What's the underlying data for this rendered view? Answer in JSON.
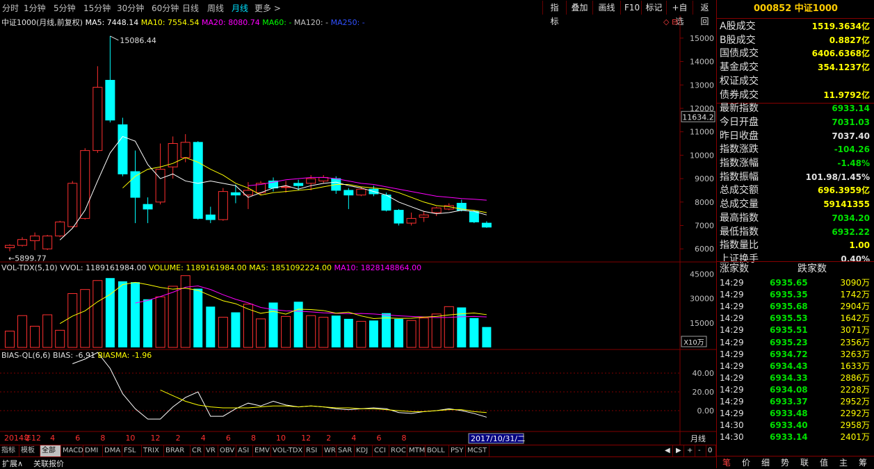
{
  "periods": [
    "分时",
    "1分钟",
    "5分钟",
    "15分钟",
    "30分钟",
    "60分钟",
    "日线",
    "周线",
    "月线",
    "更多 >"
  ],
  "active_period": "月线",
  "tools": [
    "指标",
    "叠加",
    "画线",
    "F10",
    "标记",
    "+自选",
    "返回"
  ],
  "header": {
    "name": "中证1000(月线,前复权)",
    "ma5": "MA5: 7448.14",
    "ma10": "MA10: 7554.54",
    "ma20": "MA20: 8080.74",
    "ma60": "MA60: -",
    "ma120": "MA120: -",
    "ma250": "MA250: -"
  },
  "vol_header": {
    "name": "VOL-TDX(5,10)",
    "vvol": "VVOL: 1189161984.00",
    "volume": "VOLUME: 1189161984.00",
    "ma5": "MA5: 1851092224.00",
    "ma10": "MA10: 1828148864.00"
  },
  "bias_header": {
    "name": "BIAS-QL(6,6)",
    "bias": "BIAS: -6.91",
    "biasma": "BIASMA: -1.96"
  },
  "colors": {
    "up": "#ff3030",
    "down": "#00ffff",
    "ma5": "#ffffff",
    "ma10": "#ffff00",
    "ma20": "#ff00ff",
    "ma60": "#00ff00",
    "ma250": "#0000ff",
    "grid": "#800000"
  },
  "chart_data": {
    "type": "candlestick",
    "price_axis": [
      "15000",
      "14000",
      "13000",
      "12000",
      "11000",
      "10000",
      "9000",
      "8000",
      "7000",
      "6000"
    ],
    "price_range": [
      5650,
      15500
    ],
    "high_label": "15086.44",
    "low_label": "5899.77",
    "current_tag": "11634.2",
    "candles": [
      {
        "o": 6050,
        "c": 6150,
        "h": 6200,
        "l": 5900
      },
      {
        "o": 6150,
        "c": 6400,
        "h": 6500,
        "l": 6100
      },
      {
        "o": 6350,
        "c": 6550,
        "h": 6700,
        "l": 5950
      },
      {
        "o": 6000,
        "c": 6550,
        "h": 6600,
        "l": 5950
      },
      {
        "o": 6550,
        "c": 7150,
        "h": 7200,
        "l": 6500
      },
      {
        "o": 6950,
        "c": 8800,
        "h": 8900,
        "l": 6900
      },
      {
        "o": 7300,
        "c": 10200,
        "h": 10300,
        "l": 7250
      },
      {
        "o": 10200,
        "c": 12900,
        "h": 13800,
        "l": 10100
      },
      {
        "o": 13200,
        "c": 11500,
        "h": 15086,
        "l": 11400
      },
      {
        "o": 11300,
        "c": 9200,
        "h": 11600,
        "l": 9100
      },
      {
        "o": 9300,
        "c": 8200,
        "h": 10200,
        "l": 7100
      },
      {
        "o": 7900,
        "c": 7700,
        "h": 8200,
        "l": 7100
      },
      {
        "o": 8000,
        "c": 9400,
        "h": 10500,
        "l": 7900
      },
      {
        "o": 9500,
        "c": 10500,
        "h": 10800,
        "l": 9000
      },
      {
        "o": 9900,
        "c": 10550,
        "h": 10900,
        "l": 9700
      },
      {
        "o": 10550,
        "c": 7300,
        "h": 10600,
        "l": 7250
      },
      {
        "o": 7450,
        "c": 7250,
        "h": 7800,
        "l": 7100
      },
      {
        "o": 7250,
        "c": 8450,
        "h": 8600,
        "l": 7200
      },
      {
        "o": 8400,
        "c": 8300,
        "h": 8750,
        "l": 7950
      },
      {
        "o": 8300,
        "c": 8500,
        "h": 8850,
        "l": 7700
      },
      {
        "o": 8400,
        "c": 8800,
        "h": 8900,
        "l": 8300
      },
      {
        "o": 8900,
        "c": 8600,
        "h": 9050,
        "l": 8450
      },
      {
        "o": 8650,
        "c": 8650,
        "h": 8900,
        "l": 8400
      },
      {
        "o": 8800,
        "c": 8700,
        "h": 8950,
        "l": 8500
      },
      {
        "o": 8800,
        "c": 9000,
        "h": 9150,
        "l": 8500
      },
      {
        "o": 8900,
        "c": 9050,
        "h": 9150,
        "l": 8800
      },
      {
        "o": 9000,
        "c": 8500,
        "h": 9100,
        "l": 8350
      },
      {
        "o": 8500,
        "c": 8300,
        "h": 8600,
        "l": 7700
      },
      {
        "o": 8300,
        "c": 8550,
        "h": 8650,
        "l": 8250
      },
      {
        "o": 8550,
        "c": 8350,
        "h": 8700,
        "l": 8250
      },
      {
        "o": 8300,
        "c": 7650,
        "h": 8400,
        "l": 7600
      },
      {
        "o": 7650,
        "c": 7100,
        "h": 7700,
        "l": 7000
      },
      {
        "o": 7100,
        "c": 7300,
        "h": 7550,
        "l": 7000
      },
      {
        "o": 7350,
        "c": 7450,
        "h": 7600,
        "l": 7150
      },
      {
        "o": 7550,
        "c": 7750,
        "h": 7800,
        "l": 7400
      },
      {
        "o": 7700,
        "c": 7850,
        "h": 7950,
        "l": 7650
      },
      {
        "o": 7950,
        "c": 7650,
        "h": 8100,
        "l": 7600
      },
      {
        "o": 7600,
        "c": 7150,
        "h": 7650,
        "l": 7100
      },
      {
        "o": 7100,
        "c": 6930,
        "h": 7180,
        "l": 6900
      }
    ],
    "ma5": [
      null,
      null,
      null,
      null,
      6380,
      6880,
      7650,
      8900,
      10100,
      10800,
      10600,
      9600,
      9000,
      9200,
      8900,
      8800,
      8900,
      8800,
      8700,
      8200,
      8400,
      8600,
      8700,
      8550,
      8700,
      8800,
      8850,
      8700,
      8600,
      8450,
      8300,
      8000,
      7800,
      7600,
      7500,
      7550,
      7650,
      7600,
      7450
    ],
    "ma10": [
      null,
      null,
      null,
      null,
      null,
      null,
      null,
      null,
      null,
      8600,
      9100,
      9400,
      9500,
      9650,
      9900,
      9700,
      9400,
      9150,
      8800,
      8600,
      8300,
      8400,
      8450,
      8500,
      8550,
      8650,
      8750,
      8750,
      8650,
      8600,
      8550,
      8400,
      8200,
      8000,
      7850,
      7800,
      7700,
      7650,
      7550
    ],
    "ma20": [
      null,
      null,
      null,
      null,
      null,
      null,
      null,
      null,
      null,
      null,
      null,
      null,
      null,
      null,
      null,
      null,
      null,
      null,
      null,
      8700,
      8750,
      8850,
      8950,
      9000,
      9050,
      9050,
      9000,
      8900,
      8800,
      8750,
      8650,
      8550,
      8450,
      8350,
      8250,
      8200,
      8150,
      8120,
      8080
    ],
    "vol_axis": [
      "45000",
      "30000",
      "15000"
    ],
    "vol_unit": "X10万",
    "volume": [
      10000,
      19500,
      13000,
      20000,
      10500,
      33000,
      35500,
      41000,
      42500,
      40500,
      40000,
      29500,
      31000,
      37500,
      44000,
      36000,
      25000,
      18500,
      21500,
      26500,
      17500,
      27500,
      19000,
      28000,
      19500,
      18500,
      19500,
      17500,
      16000,
      16500,
      21000,
      17500,
      16500,
      18000,
      20500,
      25000,
      24500,
      18000,
      12500
    ],
    "vol_ma5": [
      null,
      null,
      null,
      null,
      14600,
      19200,
      22400,
      28000,
      32500,
      38500,
      39900,
      38500,
      36800,
      35700,
      36300,
      35000,
      31700,
      28600,
      26800,
      23500,
      20900,
      22100,
      20400,
      23400,
      23200,
      22600,
      21000,
      21600,
      19300,
      17700,
      18100,
      17800,
      17900,
      18600,
      19000,
      19900,
      20600,
      21100,
      20100
    ],
    "vol_ma10": [
      null,
      null,
      null,
      null,
      null,
      null,
      null,
      null,
      null,
      null,
      27200,
      28800,
      31200,
      33800,
      36900,
      37700,
      35500,
      32300,
      29500,
      27300,
      24500,
      23200,
      22400,
      22200,
      21800,
      21200,
      20900,
      20700,
      20800,
      20500,
      19900,
      19400,
      19000,
      18700,
      18300,
      18400,
      18800,
      19000,
      18700
    ],
    "bias_axis": [
      "40.00",
      "20.00",
      "0.00"
    ],
    "bias": [
      null,
      null,
      null,
      null,
      null,
      50,
      55,
      62,
      45,
      18,
      2,
      -9,
      -9,
      4,
      14,
      20,
      -6,
      -6,
      2,
      8,
      5,
      10,
      6,
      4,
      5,
      4,
      2,
      1,
      2,
      3,
      2,
      -2,
      -3,
      -1,
      0,
      2,
      0,
      -3,
      -7
    ],
    "biasma": [
      null,
      null,
      null,
      null,
      null,
      null,
      null,
      null,
      null,
      null,
      null,
      null,
      22,
      16,
      10,
      6,
      4,
      3,
      3,
      3,
      4,
      5,
      5,
      4,
      5,
      4,
      3,
      3,
      2,
      2,
      1,
      0,
      -1,
      -1,
      0,
      1,
      1,
      -1,
      -2
    ],
    "x_labels": [
      "2014年12",
      "2",
      "4",
      "6",
      "8",
      "10",
      "12",
      "2",
      "4",
      "6",
      "8",
      "10",
      "12",
      "2",
      "4",
      "6",
      "8"
    ],
    "cursor_date": "2017/10/31/二",
    "period_tag": "月线"
  },
  "right_panel": {
    "title": "000852 中证1000",
    "rows": [
      {
        "label": "A股成交",
        "value": "1519.3634亿",
        "color": "#ffff00"
      },
      {
        "label": "B股成交",
        "value": "0.8827亿",
        "color": "#ffff00"
      },
      {
        "label": "国债成交",
        "value": "6406.6368亿",
        "color": "#ffff00"
      },
      {
        "label": "基金成交",
        "value": "354.1237亿",
        "color": "#ffff00"
      },
      {
        "label": "权证成交",
        "value": "",
        "color": "#ffff00"
      },
      {
        "label": "债券成交",
        "value": "11.9792亿",
        "color": "#ffff00"
      },
      {
        "label": "最新指数",
        "value": "6933.14",
        "color": "#00e000"
      },
      {
        "label": "今日开盘",
        "value": "7031.03",
        "color": "#00e000"
      },
      {
        "label": "昨日收盘",
        "value": "7037.40",
        "color": "#e0e0e0"
      },
      {
        "label": "指数涨跌",
        "value": "-104.26",
        "color": "#00e000"
      },
      {
        "label": "指数涨幅",
        "value": "-1.48%",
        "color": "#00e000"
      },
      {
        "label": "指数振幅",
        "value": "101.98/1.45%",
        "color": "#e0e0e0"
      },
      {
        "label": "总成交额",
        "value": "696.3959亿",
        "color": "#ffff00"
      },
      {
        "label": "总成交量",
        "value": "59141355",
        "color": "#ffff00"
      },
      {
        "label": "最高指数",
        "value": "7034.20",
        "color": "#00e000"
      },
      {
        "label": "最低指数",
        "value": "6932.22",
        "color": "#00e000"
      },
      {
        "label": "指数量比",
        "value": "1.00",
        "color": "#ffff00"
      },
      {
        "label": "上证换手",
        "value": "0.40%",
        "color": "#e0e0e0"
      }
    ],
    "rise_label": "涨家数",
    "fall_label": "跌家数",
    "ticks": [
      {
        "time": "14:29",
        "price": "6935.65",
        "vol": "3090万"
      },
      {
        "time": "14:29",
        "price": "6935.35",
        "vol": "1742万"
      },
      {
        "time": "14:29",
        "price": "6935.68",
        "vol": "2904万"
      },
      {
        "time": "14:29",
        "price": "6935.53",
        "vol": "1642万"
      },
      {
        "time": "14:29",
        "price": "6935.51",
        "vol": "3071万"
      },
      {
        "time": "14:29",
        "price": "6935.23",
        "vol": "2356万"
      },
      {
        "time": "14:29",
        "price": "6934.72",
        "vol": "3263万"
      },
      {
        "time": "14:29",
        "price": "6934.43",
        "vol": "1633万"
      },
      {
        "time": "14:29",
        "price": "6934.33",
        "vol": "2886万"
      },
      {
        "time": "14:29",
        "price": "6934.08",
        "vol": "2228万"
      },
      {
        "time": "14:29",
        "price": "6933.37",
        "vol": "2952万"
      },
      {
        "time": "14:29",
        "price": "6933.48",
        "vol": "2292万"
      },
      {
        "time": "14:30",
        "price": "6933.40",
        "vol": "2958万"
      },
      {
        "time": "14:30",
        "price": "6933.14",
        "vol": "2401万"
      }
    ],
    "footer": [
      "笔",
      "价",
      "细",
      "势",
      "联",
      "值",
      "主",
      "筹"
    ]
  },
  "bottom_tabs": [
    "指标",
    "模板",
    "全部",
    "MACD",
    "DMI",
    "DMA",
    "FSL",
    "TRIX",
    "BRAR",
    "CR",
    "VR",
    "OBV",
    "ASI",
    "EMV",
    "VOL-TDX",
    "RSI",
    "WR",
    "SAR",
    "KDJ",
    "CCI",
    "ROC",
    "MTM",
    "BOLL",
    "PSY",
    "MCST"
  ],
  "bottom_tab_selected": "全部",
  "bottom_nav": [
    "◀",
    "▶",
    "+",
    "-",
    "0"
  ],
  "status": [
    "扩展∧",
    "关联报价"
  ],
  "top_icons": [
    "◇",
    "⊟"
  ]
}
